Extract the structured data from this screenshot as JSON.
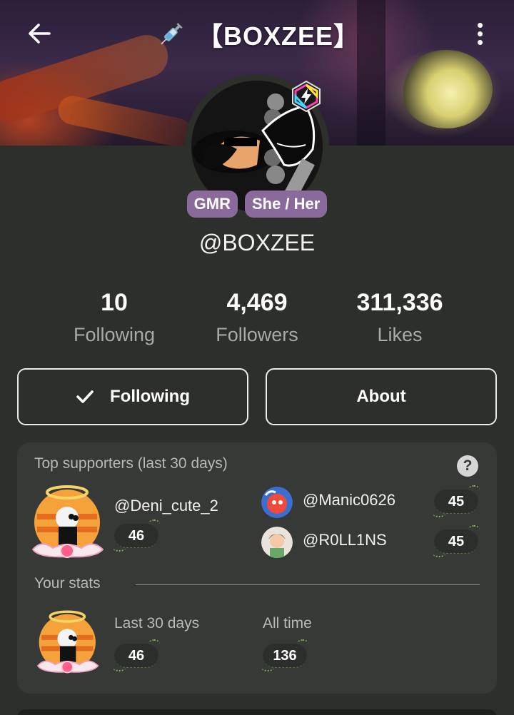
{
  "header": {
    "title": "【BOXZEE】",
    "back_icon": "arrow-left-icon",
    "menu_icon": "more-vertical-icon",
    "title_emoji": "syringe-icon"
  },
  "profile": {
    "handle": "@BOXZEE",
    "tags": [
      "GMR",
      "She / Her"
    ],
    "tag_color": "#8a6a9c"
  },
  "stats": [
    {
      "value": "10",
      "label": "Following"
    },
    {
      "value": "4,469",
      "label": "Followers"
    },
    {
      "value": "311,336",
      "label": "Likes"
    }
  ],
  "actions": {
    "following_label": "Following",
    "about_label": "About"
  },
  "supporters": {
    "title": "Top supporters (last 30 days)",
    "help": "?",
    "top": {
      "name": "@Deni_cute_2",
      "count": "46"
    },
    "others": [
      {
        "name": "@Manic0626",
        "count": "45"
      },
      {
        "name": "@R0LL1NS",
        "count": "45"
      }
    ],
    "your_stats_label": "Your stats",
    "last30_label": "Last 30 days",
    "last30_value": "46",
    "alltime_label": "All time",
    "alltime_value": "136"
  }
}
